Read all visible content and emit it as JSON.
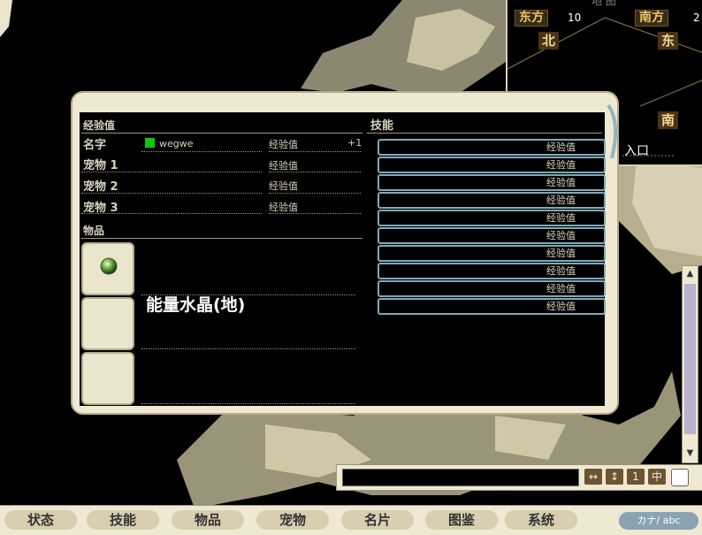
{
  "minimap": {
    "title": "地 图",
    "east_label": "东方",
    "east_value": "10",
    "south_label": "南方",
    "south_value": "2",
    "dir_north": "北",
    "dir_east": "东",
    "dir_south": "南",
    "entrance": "入口"
  },
  "status_panel": {
    "section_exp": "经验值",
    "rows": [
      {
        "label": "名字",
        "name": "wegwe",
        "exp_label": "经验值",
        "exp_value": "+1"
      },
      {
        "label": "宠物 1",
        "exp_label": "经验值"
      },
      {
        "label": "宠物 2",
        "exp_label": "经验值"
      },
      {
        "label": "宠物 3",
        "exp_label": "经验值"
      }
    ],
    "section_items": "物品",
    "section_skills": "技能",
    "skills": [
      "经验值",
      "经验值",
      "经验值",
      "经验值",
      "经验值",
      "经验值",
      "经验值",
      "经验值",
      "经验值",
      "经验值"
    ],
    "items": [
      {
        "name": "能量水晶(地)",
        "icon": "crystal-orb-icon"
      },
      {
        "name": ""
      },
      {
        "name": ""
      }
    ],
    "name_marker_color": "#16c40f"
  },
  "chat": {
    "buttons": [
      "↔",
      "↕",
      "1",
      "中"
    ]
  },
  "menu": {
    "items": [
      "状态",
      "技能",
      "物品",
      "宠物",
      "名片",
      "图鉴",
      "系统"
    ],
    "ime_label": "カナ/ abc"
  }
}
